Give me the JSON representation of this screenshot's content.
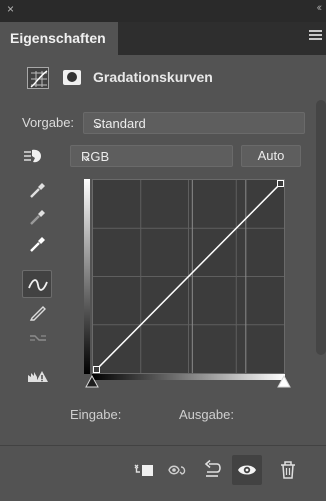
{
  "window": {
    "close_glyph": "×",
    "collapse_glyph": "‹‹"
  },
  "tab": {
    "label": "Eigenschaften",
    "menu_icon": "panel-menu-icon"
  },
  "adjustment": {
    "title": "Gradationskurven",
    "icons": [
      "curves-adjustment-icon",
      "layer-mask-icon"
    ]
  },
  "preset": {
    "label": "Vorgabe:",
    "value": "Standard"
  },
  "channel": {
    "value": "RGB",
    "auto_label": "Auto"
  },
  "tools": [
    {
      "name": "on-image-adjust-icon",
      "interactable": true
    },
    {
      "name": "sample-black-point-eyedropper-icon",
      "interactable": true
    },
    {
      "name": "sample-gray-point-eyedropper-icon",
      "interactable": true
    },
    {
      "name": "sample-white-point-eyedropper-icon",
      "interactable": true
    },
    {
      "name": "edit-points-curve-icon",
      "interactable": true,
      "active": true
    },
    {
      "name": "draw-curve-pencil-icon",
      "interactable": true
    },
    {
      "name": "smooth-curve-icon",
      "interactable": false
    },
    {
      "name": "clipping-warning-icon",
      "interactable": true
    }
  ],
  "curve": {
    "points": [
      [
        0,
        0
      ],
      [
        255,
        255
      ]
    ],
    "input_range": [
      0,
      255
    ],
    "output_range": [
      0,
      255
    ],
    "grid_divisions": 4
  },
  "io": {
    "input_label": "Eingabe:",
    "output_label": "Ausgabe:"
  },
  "bottom_actions": [
    "clip-to-layer-icon",
    "view-previous-state-icon",
    "reset-icon",
    "visibility-eye-icon",
    "delete-icon"
  ],
  "colors": {
    "panel": "#535353",
    "tab_bar": "#2e2e2e",
    "graph_bg": "#3c3c3c",
    "curve_line": "#ffffff",
    "grid": "#5f5f5f"
  }
}
